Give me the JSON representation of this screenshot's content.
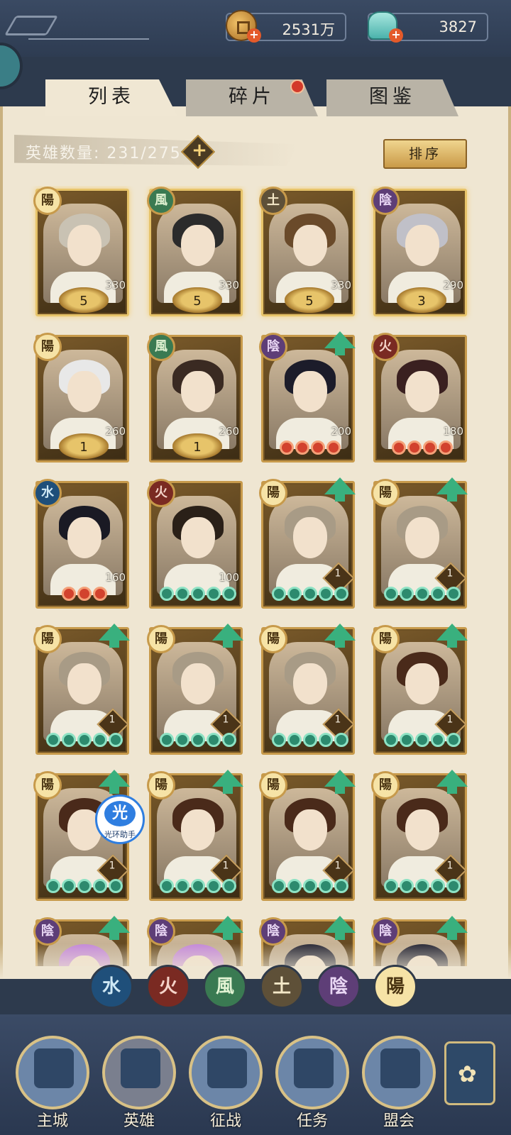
{
  "resources": {
    "coins": "2531万",
    "jade": "3827"
  },
  "tabs": [
    {
      "label": "列表",
      "active": true
    },
    {
      "label": "碎片",
      "active": false,
      "badge": true
    },
    {
      "label": "图鉴",
      "active": false
    }
  ],
  "hero_count": "英雄数量: 231/275",
  "sort_label": "排序",
  "cards": [
    {
      "elem": "陽",
      "elem_type": "yang",
      "stars": "5",
      "power": "330"
    },
    {
      "elem": "風",
      "elem_type": "wind",
      "stars": "5",
      "power": "330"
    },
    {
      "elem": "土",
      "elem_type": "earth",
      "stars": "5",
      "power": "330"
    },
    {
      "elem": "陰",
      "elem_type": "yin",
      "stars": "3",
      "power": "290"
    },
    {
      "elem": "陽",
      "elem_type": "yang",
      "stars": "1",
      "power": "260"
    },
    {
      "elem": "風",
      "elem_type": "wind",
      "stars": "1",
      "power": "260"
    },
    {
      "elem": "陰",
      "elem_type": "yin",
      "power": "200",
      "red_dots": 4,
      "upgrade": true
    },
    {
      "elem": "火",
      "elem_type": "fire",
      "power": "180",
      "red_dots": 4
    },
    {
      "elem": "水",
      "elem_type": "water",
      "power": "160",
      "red_dots": 3
    },
    {
      "elem": "火",
      "elem_type": "fire",
      "power": "100",
      "green_dots": 5
    },
    {
      "elem": "陽",
      "elem_type": "yang",
      "level": "1",
      "green_dots": 5,
      "upgrade": true
    },
    {
      "elem": "陽",
      "elem_type": "yang",
      "level": "1",
      "green_dots": 5,
      "upgrade": true
    },
    {
      "elem": "陽",
      "elem_type": "yang",
      "level": "1",
      "green_dots": 5,
      "upgrade": true
    },
    {
      "elem": "陽",
      "elem_type": "yang",
      "level": "1",
      "green_dots": 5,
      "upgrade": true
    },
    {
      "elem": "陽",
      "elem_type": "yang",
      "level": "1",
      "green_dots": 5,
      "upgrade": true
    },
    {
      "elem": "陽",
      "elem_type": "yang",
      "level": "1",
      "green_dots": 5,
      "upgrade": true
    },
    {
      "elem": "陽",
      "elem_type": "yang",
      "level": "1",
      "green_dots": 5,
      "upgrade": true
    },
    {
      "elem": "陽",
      "elem_type": "yang",
      "level": "1",
      "green_dots": 5,
      "upgrade": true
    },
    {
      "elem": "陽",
      "elem_type": "yang",
      "level": "1",
      "green_dots": 5,
      "upgrade": true
    },
    {
      "elem": "陽",
      "elem_type": "yang",
      "level": "1",
      "green_dots": 5,
      "upgrade": true
    },
    {
      "elem": "陰",
      "elem_type": "yin",
      "upgrade": true
    },
    {
      "elem": "陰",
      "elem_type": "yin",
      "upgrade": true
    },
    {
      "elem": "陰",
      "elem_type": "yin",
      "upgrade": true
    },
    {
      "elem": "陰",
      "elem_type": "yin",
      "upgrade": true
    }
  ],
  "helper": {
    "icon": "光",
    "label": "光环助手"
  },
  "element_filters": [
    {
      "glyph": "水",
      "type": "water"
    },
    {
      "glyph": "火",
      "type": "fire"
    },
    {
      "glyph": "風",
      "type": "wind"
    },
    {
      "glyph": "土",
      "type": "earth"
    },
    {
      "glyph": "陰",
      "type": "yin"
    },
    {
      "glyph": "陽",
      "type": "yang"
    }
  ],
  "nav": [
    {
      "label": "主城",
      "icon": "castle-icon"
    },
    {
      "label": "英雄",
      "icon": "hero-icon",
      "active": true
    },
    {
      "label": "征战",
      "icon": "battle-icon"
    },
    {
      "label": "任务",
      "icon": "quest-icon"
    },
    {
      "label": "盟会",
      "icon": "guild-icon"
    }
  ],
  "colors": {
    "frame_bg": "#efe6d2",
    "nav_bg": "#2d3a4d",
    "gold": "#c79a4b",
    "upgrade_green": "#39b07e",
    "red_gem": "#d2422e",
    "green_gem": "#2d8a6e"
  }
}
